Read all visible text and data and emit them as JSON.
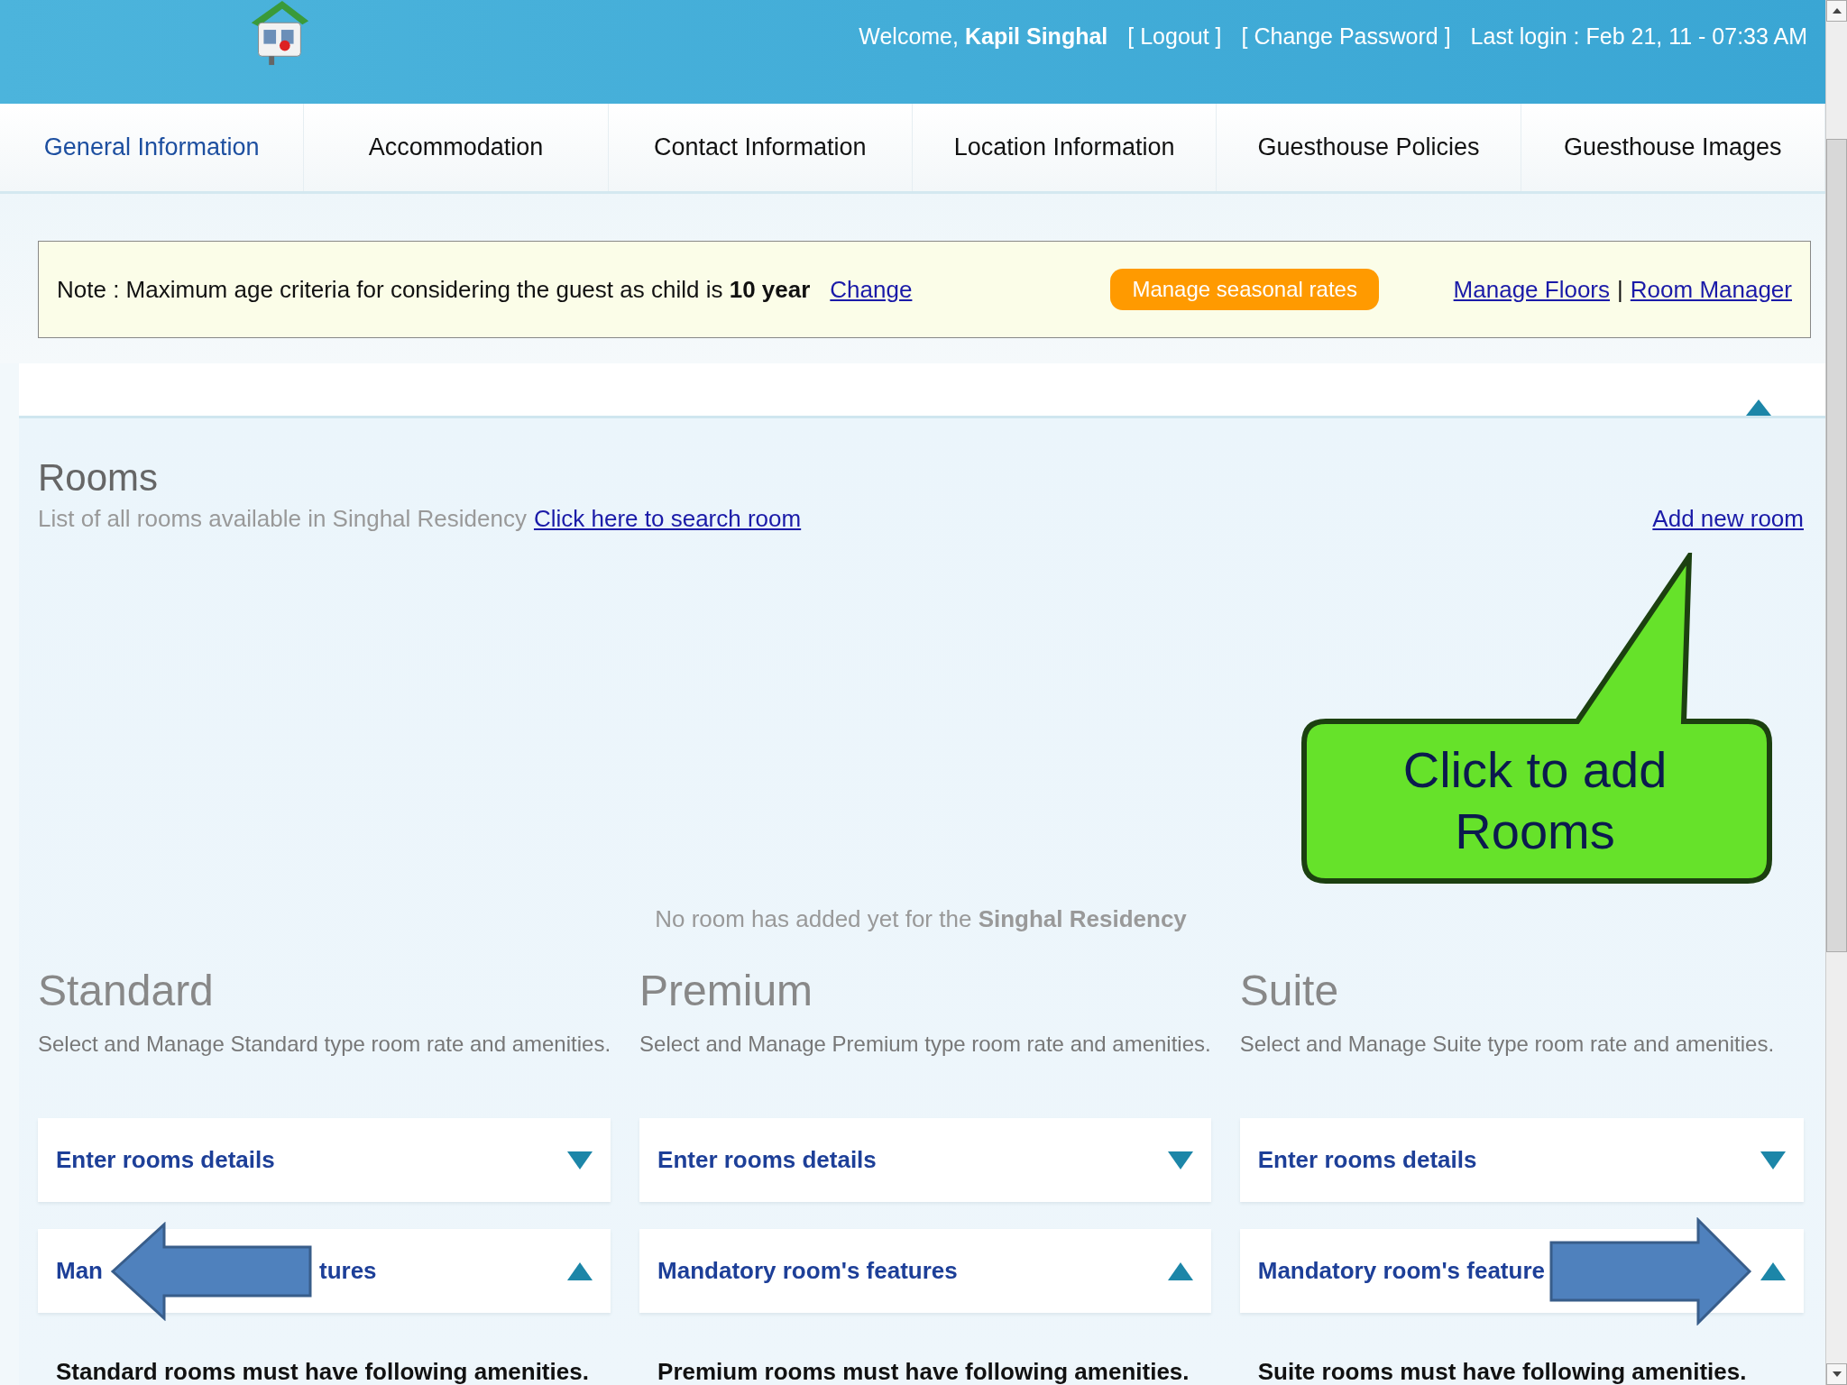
{
  "header": {
    "welcome": "Welcome,",
    "user": "Kapil Singhal",
    "links": [
      "[ Logout ]",
      "[ Change Password ]"
    ],
    "last_login": "Last login : Feb 21, 11 - 07:33 AM"
  },
  "tabs": [
    {
      "label": "General Information",
      "selected": true
    },
    {
      "label": "Accommodation",
      "selected": false
    },
    {
      "label": "Contact Information",
      "selected": false
    },
    {
      "label": "Location Information",
      "selected": false
    },
    {
      "label": "Guesthouse Policies",
      "selected": false
    },
    {
      "label": "Guesthouse Images",
      "selected": false
    }
  ],
  "note": {
    "text": "Note : Maximum age criteria for considering the guest as child is **10 year**",
    "change_link": "Change",
    "seasonal_button": "Manage seasonal rates",
    "links": [
      "Manage Floors",
      "Room Manager"
    ],
    "separator": "|"
  },
  "rooms": {
    "title": "Rooms",
    "subtitle": "List of all rooms available in Singhal Residency",
    "search_link": "Click here to search room",
    "add_link": "Add new room",
    "empty_text": "No room has added yet for the **Singhal Residency**"
  },
  "callout": {
    "text": "Click to add Rooms"
  },
  "room_types": [
    {
      "title": "Standard",
      "description": "Select and Manage Standard type room rate and amenities.",
      "panels": [
        {
          "parts": [
            {
              "text": "Enter rooms details"
            }
          ],
          "expanded": false
        },
        {
          "parts": [
            {
              "text": "Man"
            },
            {
              "text": "tures"
            }
          ],
          "expanded": true
        }
      ],
      "amenities_note": "Standard rooms must have following amenities.",
      "overlay": {
        "kind": "arrow-left"
      }
    },
    {
      "title": "Premium",
      "description": "Select and Manage Premium type room rate and amenities.",
      "panels": [
        {
          "parts": [
            {
              "text": "Enter rooms details"
            }
          ],
          "expanded": false
        },
        {
          "parts": [
            {
              "text": "Mandatory room's features"
            }
          ],
          "expanded": true
        }
      ],
      "amenities_note": "Premium rooms must have following amenities."
    },
    {
      "title": "Suite",
      "description": "Select and Manage Suite type room rate and amenities.",
      "panels": [
        {
          "parts": [
            {
              "text": "Enter rooms details"
            }
          ],
          "expanded": false
        },
        {
          "parts": [
            {
              "text": "Mandatory room's feature"
            }
          ],
          "expanded": true
        }
      ],
      "amenities_note": "Suite rooms must have following amenities.",
      "overlay": {
        "kind": "arrow-right"
      }
    }
  ]
}
